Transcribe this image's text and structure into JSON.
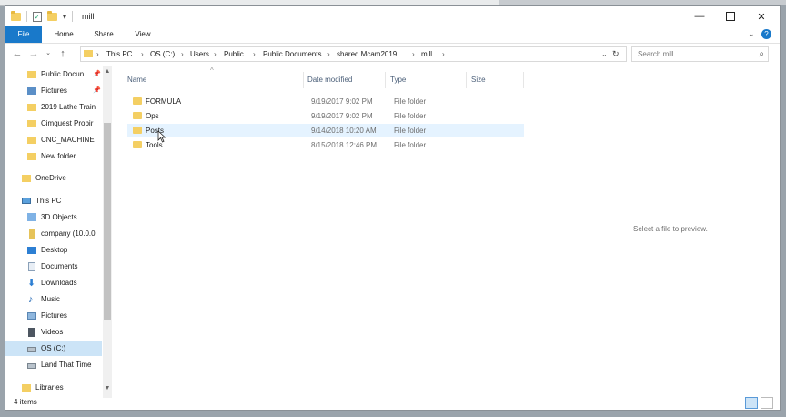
{
  "window": {
    "title": "mill",
    "colors": {
      "accent": "#1979ca",
      "folder": "#f4cf63",
      "selection": "#cce4f7",
      "hover": "#e5f3ff"
    }
  },
  "ribbon": {
    "tabs": [
      {
        "label": "File"
      },
      {
        "label": "Home"
      },
      {
        "label": "Share"
      },
      {
        "label": "View"
      }
    ]
  },
  "address": {
    "crumbs": [
      "This PC",
      "OS (C:)",
      "Users",
      "Public",
      "Public Documents",
      "shared Mcam2019",
      "mill"
    ]
  },
  "search": {
    "placeholder": "Search mill"
  },
  "nav": {
    "items": [
      {
        "label": "Public Docun",
        "icon": "folder-icon",
        "pinned": true
      },
      {
        "label": "Pictures",
        "icon": "pictures-icon",
        "pinned": true
      },
      {
        "label": "2019 Lathe Train",
        "icon": "folder-icon"
      },
      {
        "label": "Cimquest Probir",
        "icon": "folder-icon"
      },
      {
        "label": "CNC_MACHINE",
        "icon": "folder-icon"
      },
      {
        "label": "New folder",
        "icon": "folder-icon"
      },
      {
        "label": "OneDrive",
        "icon": "onedrive-icon"
      },
      {
        "label": "This PC",
        "icon": "computer-icon"
      },
      {
        "label": "3D Objects",
        "icon": "3d-objects-icon"
      },
      {
        "label": "company (10.0.0",
        "icon": "network-drive-icon"
      },
      {
        "label": "Desktop",
        "icon": "desktop-icon"
      },
      {
        "label": "Documents",
        "icon": "documents-icon"
      },
      {
        "label": "Downloads",
        "icon": "downloads-icon"
      },
      {
        "label": "Music",
        "icon": "music-icon"
      },
      {
        "label": "Pictures",
        "icon": "pictures-icon"
      },
      {
        "label": "Videos",
        "icon": "videos-icon"
      },
      {
        "label": "OS (C:)",
        "icon": "drive-icon",
        "selected": true
      },
      {
        "label": "Land That Time",
        "icon": "drive-icon"
      },
      {
        "label": "Libraries",
        "icon": "libraries-icon"
      }
    ]
  },
  "columns": {
    "name": "Name",
    "date": "Date modified",
    "type": "Type",
    "size": "Size"
  },
  "files": [
    {
      "name": "FORMULA",
      "date": "9/19/2017 9:02 PM",
      "type": "File folder"
    },
    {
      "name": "Ops",
      "date": "9/19/2017 9:02 PM",
      "type": "File folder"
    },
    {
      "name": "Posts",
      "date": "9/14/2018 10:20 AM",
      "type": "File folder",
      "hover": true
    },
    {
      "name": "Tools",
      "date": "8/15/2018 12:46 PM",
      "type": "File folder"
    }
  ],
  "preview": {
    "text": "Select a file to preview."
  },
  "status": {
    "count": "4 items"
  }
}
